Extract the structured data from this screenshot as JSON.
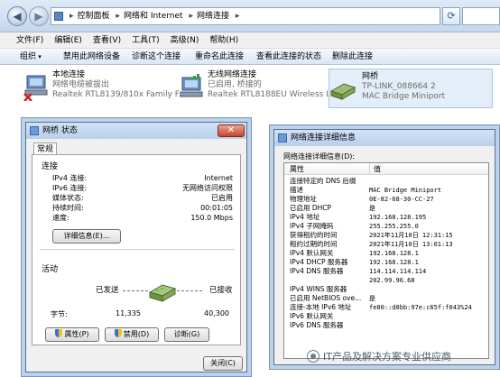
{
  "address": {
    "crumbs": [
      "控制面板",
      "网络和 Internet",
      "网络连接"
    ]
  },
  "menu": [
    "文件(F)",
    "编辑(E)",
    "查看(V)",
    "工具(T)",
    "高级(N)",
    "帮助(H)"
  ],
  "toolbar": [
    "组织",
    "禁用此网络设备",
    "诊断这个连接",
    "重命名此连接",
    "查看此连接的状态",
    "删除此连接"
  ],
  "connections": [
    {
      "name": "本地连接",
      "status": "网络电缆被拔出",
      "adapter": "Realtek RTL8139/810x Family F..."
    },
    {
      "name": "无线网络连接",
      "status": "已启用, 桥接的",
      "adapter": "Realtek RTL8188EU Wireless L..."
    },
    {
      "name": "网桥",
      "status": "TP-LINK_088664  2",
      "adapter": "MAC Bridge Miniport"
    }
  ],
  "status_dialog": {
    "title": "网桥 状态",
    "tab": "常规",
    "connection_header": "连接",
    "rows": [
      {
        "k": "IPv4 连接:",
        "v": "Internet"
      },
      {
        "k": "IPv6 连接:",
        "v": "无网络访问权限"
      },
      {
        "k": "媒体状态:",
        "v": "已启用"
      },
      {
        "k": "持续时间:",
        "v": "00:01:05"
      },
      {
        "k": "速度:",
        "v": "150.0 Mbps"
      }
    ],
    "details_button": "详细信息(E)...",
    "activity_header": "活动",
    "sent_label": "已发送",
    "received_label": "已接收",
    "bytes_label": "字节:",
    "bytes_sent": "11,335",
    "bytes_received": "40,300",
    "properties_button": "属性(P)",
    "disable_button": "禁用(D)",
    "diagnose_button": "诊断(G)",
    "close_button": "关闭(C)"
  },
  "details_dialog": {
    "title": "网络连接详细信息",
    "label": "网络连接详细信息(D):",
    "col_property": "属性",
    "col_value": "值",
    "rows": [
      {
        "k": "连接特定的 DNS 后缀",
        "v": ""
      },
      {
        "k": "描述",
        "v": "MAC Bridge Miniport"
      },
      {
        "k": "物理地址",
        "v": "0E-82-68-30-CC-27"
      },
      {
        "k": "已启用 DHCP",
        "v": "是"
      },
      {
        "k": "IPv4 地址",
        "v": "192.168.128.195"
      },
      {
        "k": "IPv4 子网掩码",
        "v": "255.255.255.0"
      },
      {
        "k": "获得租约的时间",
        "v": "2021年11月10日 12:31:15"
      },
      {
        "k": "租约过期的时间",
        "v": "2021年11月10日 13:01:13"
      },
      {
        "k": "IPv4 默认网关",
        "v": "192.168.128.1"
      },
      {
        "k": "IPv4 DHCP 服务器",
        "v": "192.168.128.1"
      },
      {
        "k": "IPv4 DNS 服务器",
        "v": "114.114.114.114"
      },
      {
        "k": "",
        "v": "202.99.96.68"
      },
      {
        "k": "IPv4 WINS 服务器",
        "v": ""
      },
      {
        "k": "已启用 NetBIOS ove...",
        "v": "是"
      },
      {
        "k": "连接-本地 IPv6 地址",
        "v": "fe80::d8bb:97e:c65f:f043%24"
      },
      {
        "k": "IPv6 默认网关",
        "v": ""
      },
      {
        "k": "IPv6 DNS 服务器",
        "v": ""
      }
    ]
  },
  "watermark": "IT产品及解决方案专业供应商"
}
